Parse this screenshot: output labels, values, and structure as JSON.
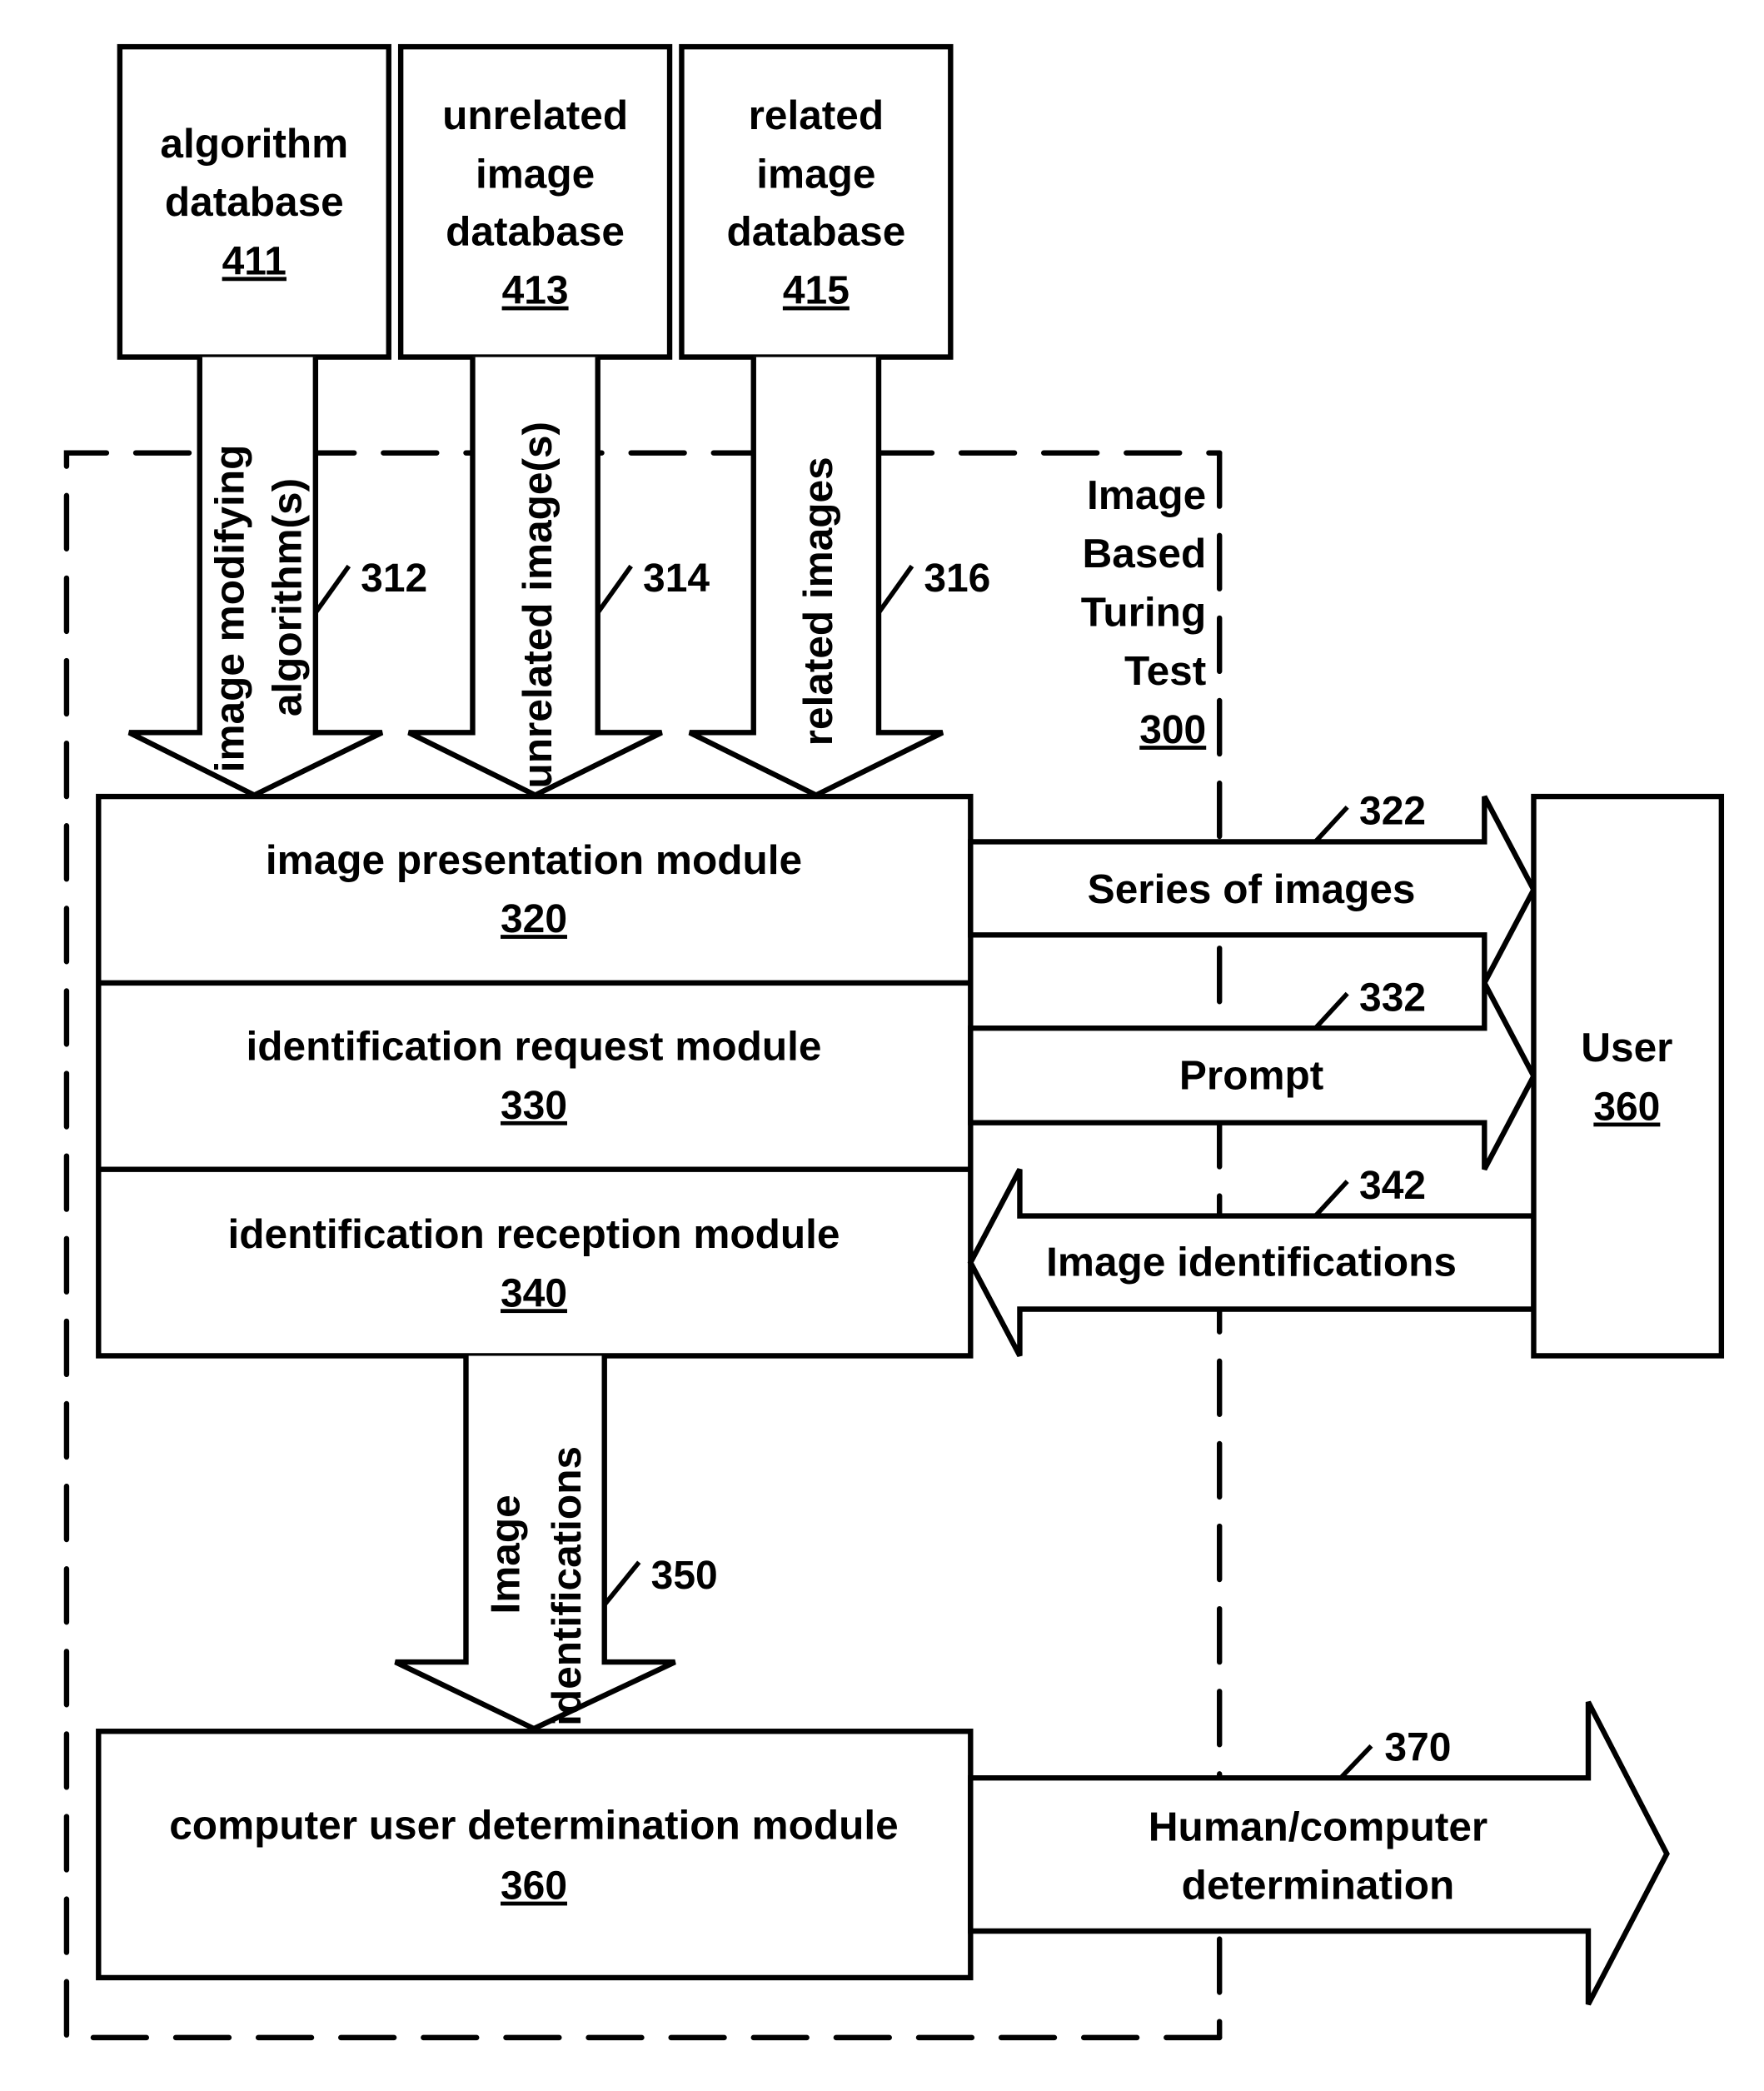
{
  "diagram": {
    "system": {
      "lines": [
        "Image",
        "Based",
        "Turing",
        "Test"
      ],
      "ref": "300"
    },
    "databases": [
      {
        "lines": [
          "algorithm",
          "database"
        ],
        "ref": "411"
      },
      {
        "lines": [
          "unrelated",
          "image",
          "database"
        ],
        "ref": "413"
      },
      {
        "lines": [
          "related",
          "image",
          "database"
        ],
        "ref": "415"
      }
    ],
    "input_arrows": [
      {
        "lines": [
          "image modifying",
          "algorithm(s)"
        ],
        "ref": "312"
      },
      {
        "lines": [
          "unrelated image(s)"
        ],
        "ref": "314"
      },
      {
        "lines": [
          "related images"
        ],
        "ref": "316"
      }
    ],
    "modules": [
      {
        "label": "image presentation module",
        "ref": "320"
      },
      {
        "label": "identification request module",
        "ref": "330"
      },
      {
        "label": "identification reception module",
        "ref": "340"
      }
    ],
    "user": {
      "label": "User",
      "ref": "360"
    },
    "io_arrows": [
      {
        "label": "Series of images",
        "ref": "322",
        "direction": "to-user"
      },
      {
        "label": "Prompt",
        "ref": "332",
        "direction": "to-user"
      },
      {
        "label": "Image identifications",
        "ref": "342",
        "direction": "from-user"
      }
    ],
    "down_arrow": {
      "lines": [
        "Image",
        "identifications"
      ],
      "ref": "350"
    },
    "determination_module": {
      "label": "computer user determination module",
      "ref": "360"
    },
    "output_arrow": {
      "lines": [
        "Human/computer",
        "determination"
      ],
      "ref": "370"
    }
  }
}
